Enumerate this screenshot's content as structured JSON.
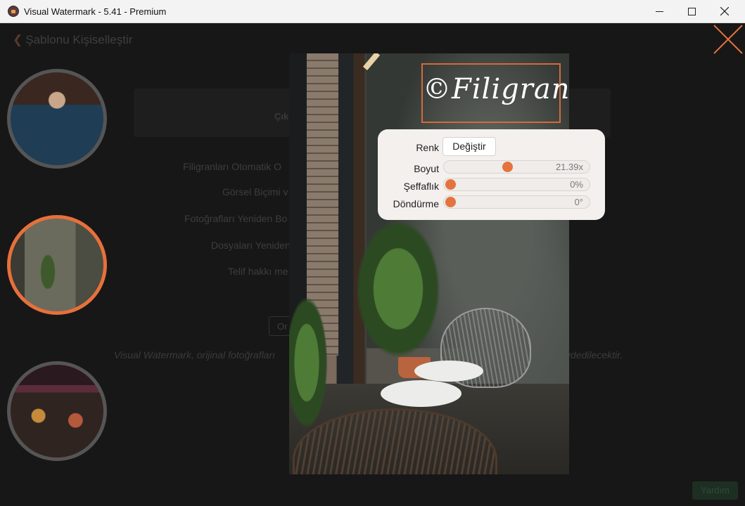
{
  "window": {
    "title": "Visual Watermark - 5.41 - Premium"
  },
  "background": {
    "back_label": "Şablonu Kişiselleştir",
    "panel_label": "Çık",
    "rows": [
      "Filigranları Otomatik O",
      "Görsel Biçimi v",
      "Fotoğrafları Yeniden Bo",
      "Dosyaları Yeniden",
      "Telif hakkı me"
    ],
    "button_label": "Or",
    "footer_left": "Visual Watermark, orijinal fotoğrafları",
    "footer_right": "ydedilecektir.",
    "help_label": "Yardım"
  },
  "watermark": {
    "text": "©Filigran"
  },
  "panel": {
    "color_label": "Renk",
    "change_button": "Değiştir",
    "size_label": "Boyut",
    "size_value": "21.39x",
    "size_level": 0.43,
    "opacity_label": "Şeffaflık",
    "opacity_value": "0%",
    "opacity_level": 0,
    "rotation_label": "Döndürme",
    "rotation_value": "0°",
    "rotation_level": 0
  },
  "colors": {
    "accent": "#e5733d",
    "panel_bg": "#f3f0ee"
  }
}
